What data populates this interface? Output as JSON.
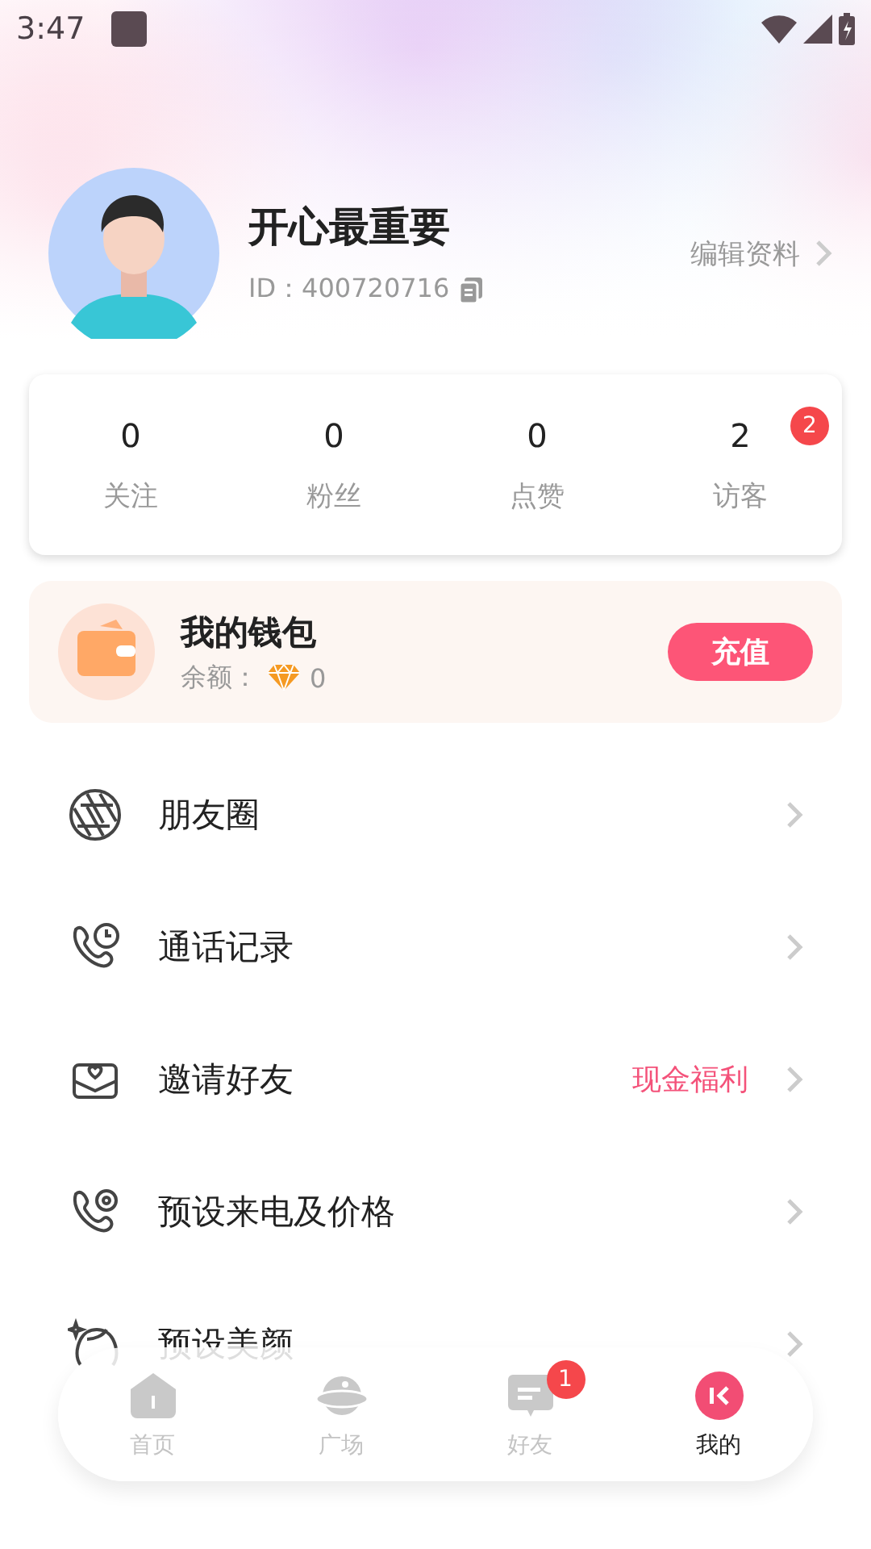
{
  "status_bar": {
    "time": "3:47"
  },
  "profile": {
    "name": "开心最重要",
    "id": "ID：400720716",
    "edit": "编辑资料"
  },
  "stats": [
    {
      "value": "0",
      "label": "关注"
    },
    {
      "value": "0",
      "label": "粉丝"
    },
    {
      "value": "0",
      "label": "点赞"
    },
    {
      "value": "2",
      "label": "访客",
      "badge": "2"
    }
  ],
  "wallet": {
    "title": "我的钱包",
    "balance_label": "余额：",
    "balance": "0",
    "button": "充值"
  },
  "menu": [
    {
      "label": "朋友圈"
    },
    {
      "label": "通话记录"
    },
    {
      "label": "邀请好友",
      "tag": "现金福利"
    },
    {
      "label": "预设来电及价格"
    },
    {
      "label": "预设美颜"
    }
  ],
  "tabs": [
    {
      "label": "首页",
      "selected": false
    },
    {
      "label": "广场",
      "selected": false
    },
    {
      "label": "好友",
      "selected": false,
      "badge": "1"
    },
    {
      "label": "我的",
      "selected": true
    }
  ]
}
